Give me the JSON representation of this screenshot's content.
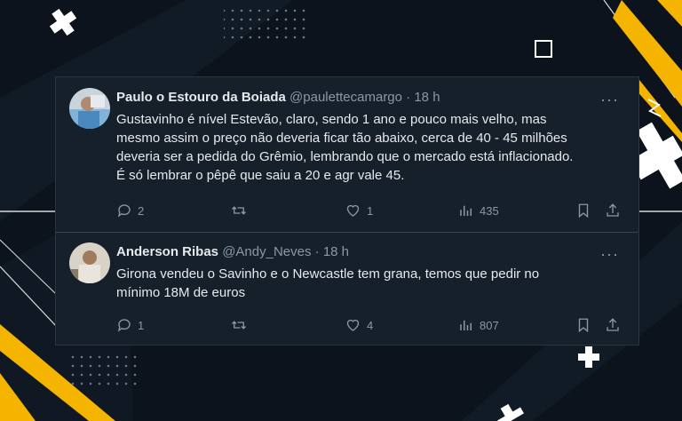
{
  "tweets": [
    {
      "name": "Paulo o Estouro da Boiada",
      "handle": "@paulettecamargo",
      "separator": "·",
      "time": "18 h",
      "more": "···",
      "body_lines": [
        "Gustavinho é nível Estevão, claro, sendo 1 ano e pouco mais velho, mas",
        "mesmo assim o preço não deveria ficar tão abaixo, cerca de 40 - 45 milhões",
        "deveria ser a pedida do Grêmio, lembrando que o mercado está  inflacionado.",
        "É só lembrar o pêpê que saiu a 20 e agr vale 45."
      ],
      "replies": "2",
      "retweets": "",
      "likes": "1",
      "views": "435"
    },
    {
      "name": "Anderson Ribas",
      "handle": "@Andy_Neves",
      "separator": "·",
      "time": "18 h",
      "more": "···",
      "body_lines": [
        "Girona vendeu o Savinho e o Newcastle tem grana, temos que pedir no",
        "mínimo 18M de euros"
      ],
      "replies": "1",
      "retweets": "",
      "likes": "4",
      "views": "807"
    }
  ],
  "icons": {
    "reply": "reply-icon",
    "retweet": "retweet-icon",
    "like": "heart-icon",
    "views": "views-chart-icon",
    "bookmark": "bookmark-icon",
    "share": "share-icon",
    "more": "more-dots-icon"
  },
  "colors": {
    "background": "#0c131c",
    "card": "#15202b",
    "text": "#e7e9ea",
    "muted": "#8b98a5",
    "accent_yellow": "#f5b400",
    "decor_white": "#ffffff"
  }
}
